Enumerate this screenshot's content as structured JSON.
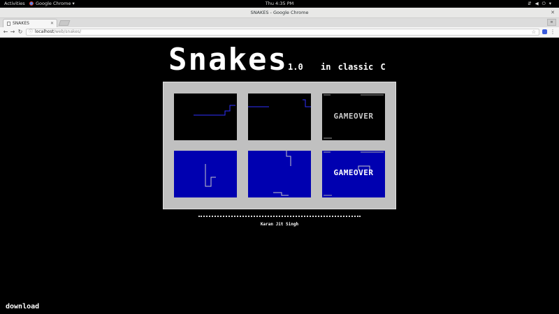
{
  "topbar": {
    "activities": "Activities",
    "app_name": "Google Chrome",
    "clock": "Thu  4:35 PM",
    "tray_icons": [
      "network-icon",
      "volume-icon",
      "power-icon"
    ]
  },
  "window": {
    "title": "SNAKES - Google Chrome"
  },
  "tabs": [
    {
      "title": "SNAKES"
    }
  ],
  "toolbar": {
    "url_host": "localhost",
    "url_path": "/web/snakes/"
  },
  "page": {
    "logo": "Snakes",
    "version": "1.0",
    "tagline": "in classic C",
    "screenshots": [
      {
        "theme": "black",
        "text": ""
      },
      {
        "theme": "black",
        "text": ""
      },
      {
        "theme": "black",
        "text": "GAMEOVER"
      },
      {
        "theme": "blue",
        "text": ""
      },
      {
        "theme": "blue",
        "text": ""
      },
      {
        "theme": "blue",
        "text": "GAMEOVER"
      }
    ],
    "author": "Karan Jit Singh",
    "download_link": "download"
  },
  "colors": {
    "page_background": "#000000",
    "gallery_frame": "#c0c0c0",
    "blue_screen": "#0000b0",
    "snake_blue": "#3030ff",
    "snake_grey": "#c8c8c8"
  }
}
